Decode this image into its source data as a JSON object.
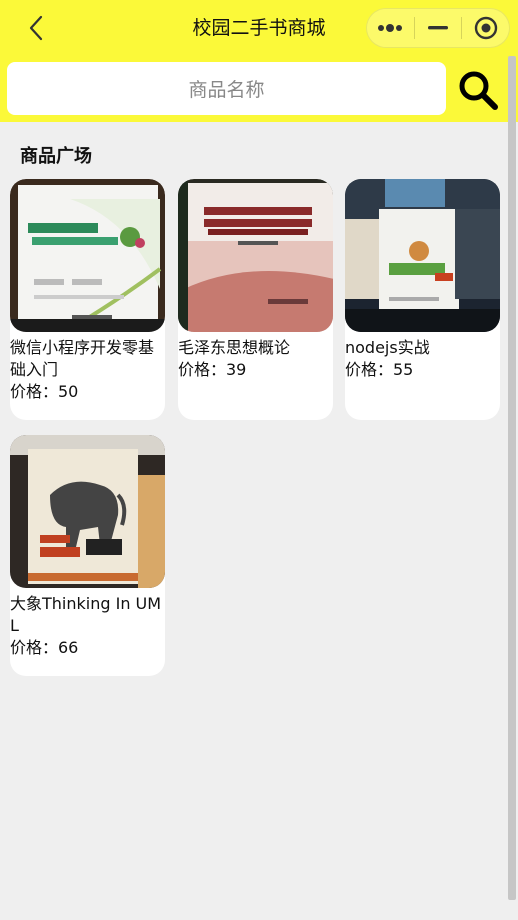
{
  "navbar": {
    "title": "校园二手书商城",
    "back_icon": "chevron-left-icon",
    "menu_icon": "more-dots-icon",
    "minimize_icon": "minus-icon",
    "close_icon": "target-circle-icon",
    "background": "#fbf939"
  },
  "search": {
    "placeholder": "商品名称",
    "icon": "search-icon"
  },
  "section": {
    "title": "商品广场"
  },
  "products": [
    {
      "name": "微信小程序开发零基础入门",
      "price_label": "价格：50",
      "price": 50
    },
    {
      "name": "毛泽东思想概论",
      "price_label": "价格：39",
      "price": 39
    },
    {
      "name": "nodejs实战",
      "price_label": "价格：55",
      "price": 55
    },
    {
      "name": "大象Thinking In UML",
      "price_label": "价格：66",
      "price": 66
    }
  ]
}
